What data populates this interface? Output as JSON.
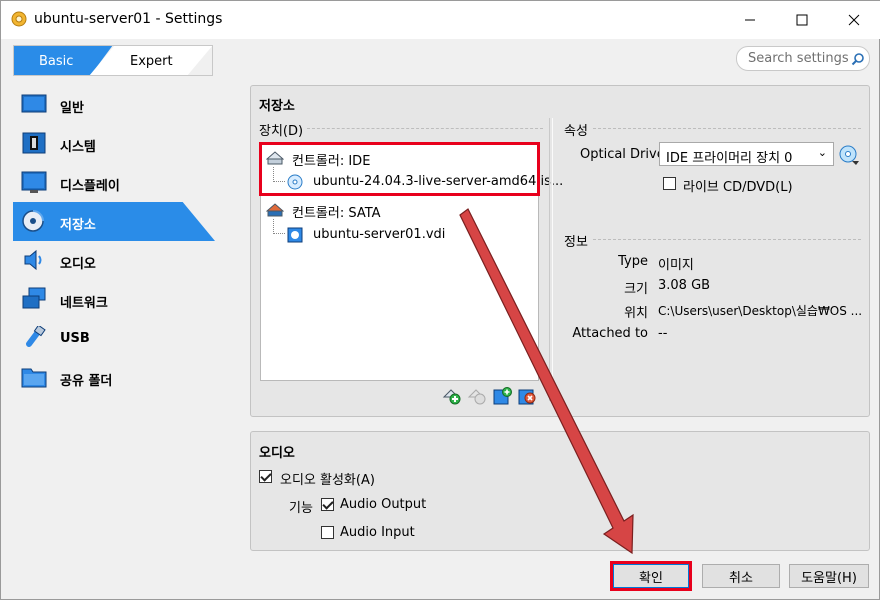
{
  "window": {
    "title": "ubuntu-server01 - Settings"
  },
  "mode": {
    "basic": "Basic",
    "expert": "Expert"
  },
  "search": {
    "placeholder": "Search settings"
  },
  "sidebar": {
    "items": [
      {
        "label": "일반",
        "icon": "general-icon"
      },
      {
        "label": "시스템",
        "icon": "system-icon"
      },
      {
        "label": "디스플레이",
        "icon": "display-icon"
      },
      {
        "label": "저장소",
        "icon": "storage-icon",
        "active": true
      },
      {
        "label": "오디오",
        "icon": "audio-icon"
      },
      {
        "label": "네트워크",
        "icon": "network-icon"
      },
      {
        "label": "USB",
        "icon": "usb-icon"
      },
      {
        "label": "공유 폴더",
        "icon": "shared-folder-icon"
      }
    ]
  },
  "storage": {
    "title": "저장소",
    "devices_label": "장치(D)",
    "tree": {
      "controller_ide": "컨트롤러: IDE",
      "ide_item": "ubuntu-24.04.3-live-server-amd64.is...",
      "controller_sata": "컨트롤러: SATA",
      "sata_item": "ubuntu-server01.vdi"
    },
    "attributes_label": "속성",
    "optical_drive_label": "Optical Drive",
    "optical_drive_value": "IDE 프라이머리 장치 0",
    "live_cd_label": "라이브 CD/DVD(L)",
    "live_cd_checked": false,
    "info_label": "정보",
    "info": [
      {
        "key": "Type",
        "value": "이미지"
      },
      {
        "key": "크기",
        "value": "3.08 GB"
      },
      {
        "key": "위치",
        "value": "C:\\Users\\user\\Desktop\\실습₩OS ..."
      },
      {
        "key": "Attached to",
        "value": "--"
      }
    ]
  },
  "audio": {
    "title": "오디오",
    "enable_label": "오디오 활성화(A)",
    "enable_checked": true,
    "features_label": "기능",
    "output_label": "Audio Output",
    "output_checked": true,
    "input_label": "Audio Input",
    "input_checked": false
  },
  "buttons": {
    "ok": "확인",
    "cancel": "취소",
    "help": "도움말(H)"
  },
  "colors": {
    "accent": "#2a8ce8",
    "highlight": "#e8001c",
    "arrow": "#d64545"
  }
}
